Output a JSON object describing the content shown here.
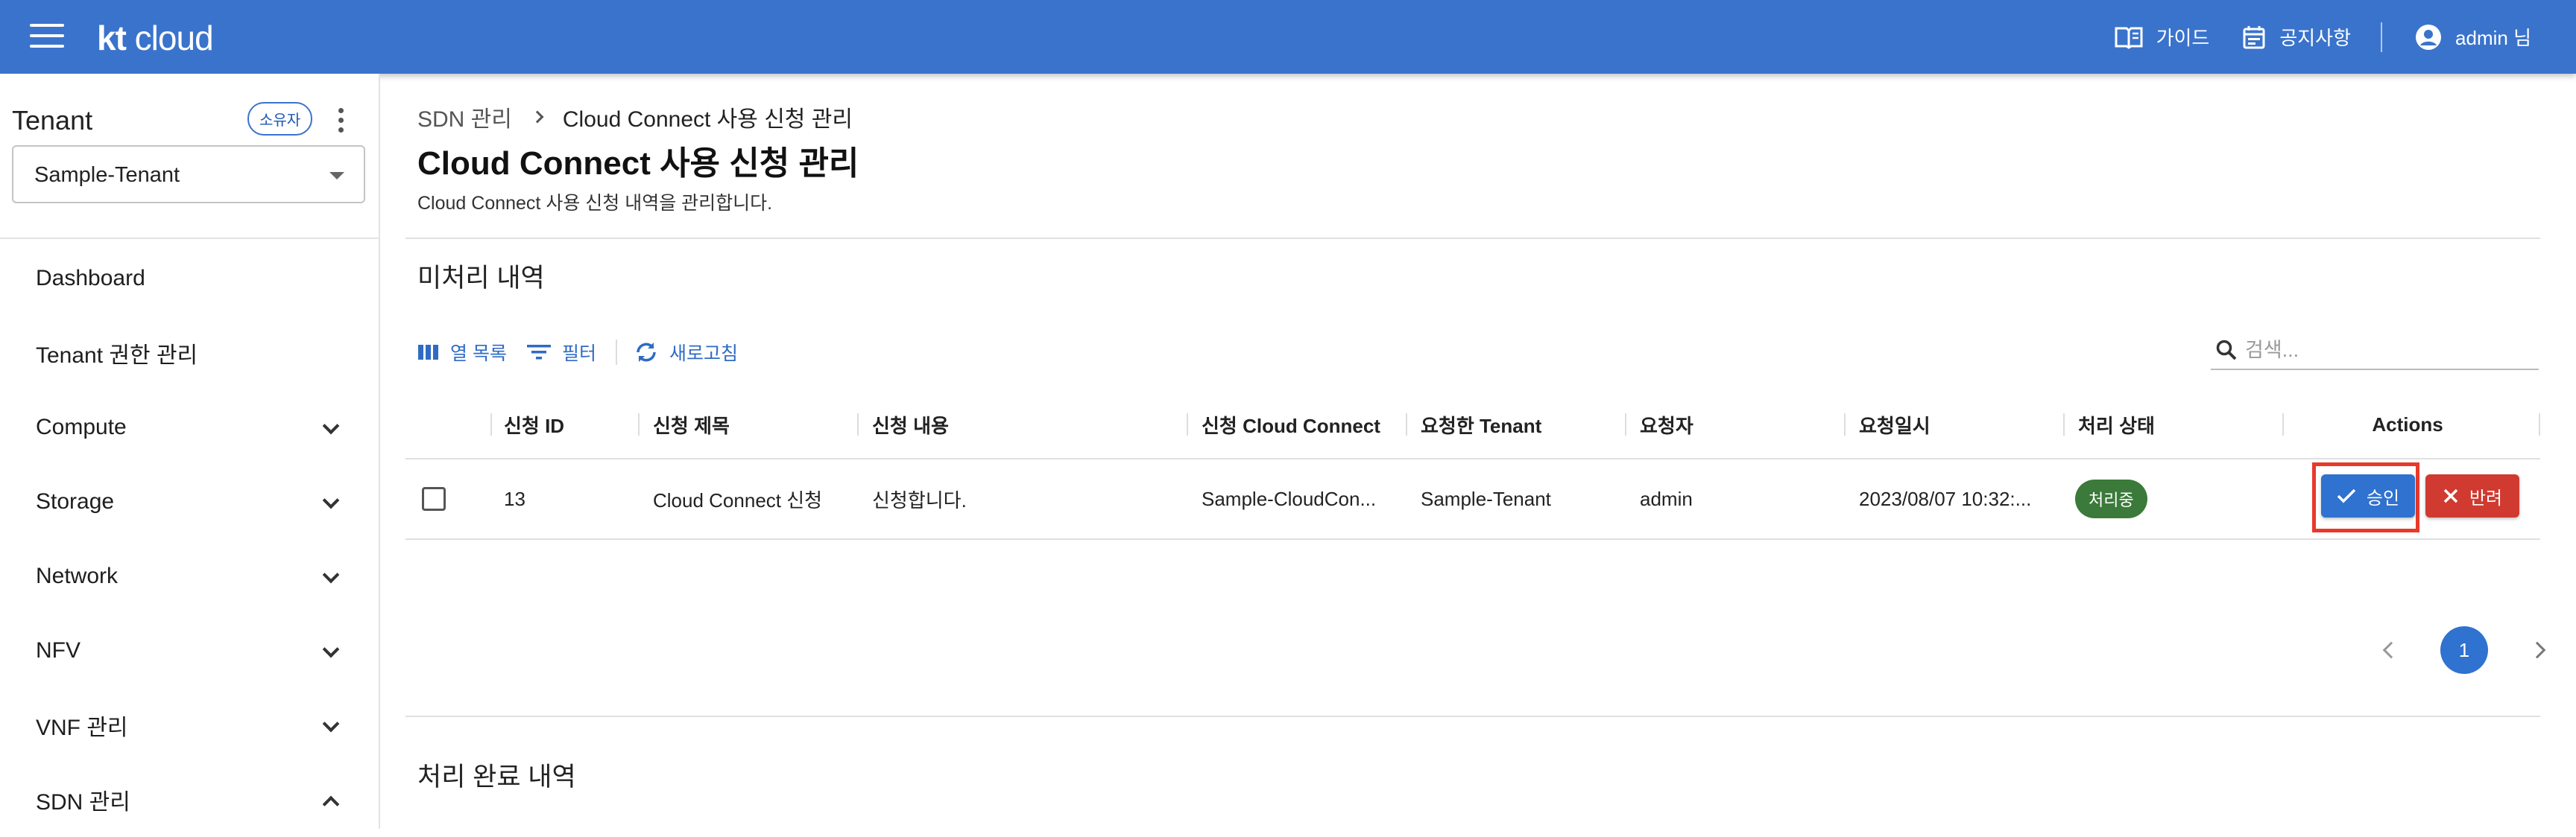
{
  "header": {
    "logo_bold": "kt",
    "logo_thin": " cloud",
    "guide_label": "가이드",
    "notice_label": "공지사항",
    "user_label": "admin 님",
    "bar_color": "#3a73cc"
  },
  "sidebar": {
    "tenant_title": "Tenant",
    "owner_badge": "소유자",
    "tenant_select_value": "Sample-Tenant",
    "items": [
      {
        "label": "Dashboard",
        "expandable": false
      },
      {
        "label": "Tenant 권한 관리",
        "expandable": false
      },
      {
        "label": "Compute",
        "expandable": true
      },
      {
        "label": "Storage",
        "expandable": true
      },
      {
        "label": "Network",
        "expandable": true
      },
      {
        "label": "NFV",
        "expandable": true
      },
      {
        "label": "VNF 관리",
        "expandable": true
      },
      {
        "label": "SDN 관리",
        "expandable": true,
        "expanded": true
      }
    ]
  },
  "main": {
    "breadcrumb": {
      "parent": "SDN 관리",
      "current": "Cloud Connect 사용 신청 관리"
    },
    "title": "Cloud Connect 사용 신청 관리",
    "description": "Cloud Connect 사용 신청 내역을 관리합니다.",
    "pending_section_title": "미처리 내역",
    "done_section_title": "처리 완료 내역",
    "toolbar": {
      "columns_label": "열 목록",
      "filter_label": "필터",
      "refresh_label": "새로고침",
      "search_placeholder": "검색..."
    },
    "table": {
      "columns": [
        "신청 ID",
        "신청 제목",
        "신청 내용",
        "신청 Cloud Connect",
        "요청한 Tenant",
        "요청자",
        "요청일시",
        "처리 상태",
        "Actions"
      ],
      "rows": [
        {
          "id": "13",
          "title": "Cloud Connect 신청",
          "content": "신청합니다.",
          "cloud_connect": "Sample-CloudCon...",
          "tenant": "Sample-Tenant",
          "requester": "admin",
          "requested_at": "2023/08/07 10:32:...",
          "status": "처리중",
          "approve_label": "승인",
          "reject_label": "반려"
        }
      ]
    },
    "pagination": {
      "current_page": "1"
    },
    "colors": {
      "accent": "#2f72d0",
      "status_processing": "#3b7a3a",
      "reject": "#d03a30",
      "highlight": "#e8392b"
    }
  }
}
